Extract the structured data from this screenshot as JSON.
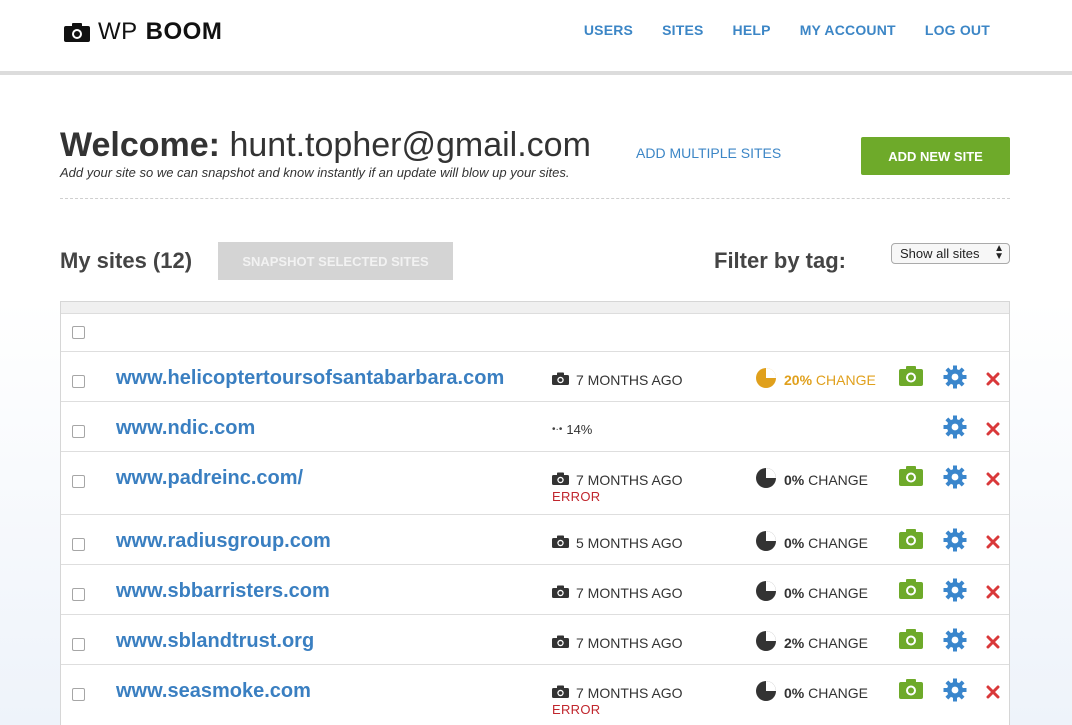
{
  "header": {
    "brand_a": "WP",
    "brand_b": "BOOM",
    "nav": [
      "USERS",
      "SITES",
      "HELP",
      "MY ACCOUNT",
      "LOG OUT"
    ]
  },
  "welcome": {
    "label": "Welcome:",
    "email": "hunt.topher@gmail.com",
    "subtitle": "Add your site so we can snapshot and know instantly if an update will blow up your sites.",
    "add_multiple": "ADD MULTIPLE SITES",
    "add_new": "ADD NEW SITE"
  },
  "toolbar": {
    "my_sites": "My sites (12)",
    "snapshot_selected": "SNAPSHOT SELECTED SITES",
    "filter_label": "Filter by tag:",
    "filter_value": "Show all sites"
  },
  "colors": {
    "link": "#3a7fc1",
    "accent_green": "#6eaa2a",
    "warn": "#e0a01c",
    "error": "#c0262d",
    "delete": "#d9383a"
  },
  "sites": [
    {
      "url": "www.helicoptertoursofsantabarbara.com",
      "when": "7 MONTHS AGO",
      "error": "",
      "pct": "20%",
      "change": "CHANGE",
      "fraction": 0.2,
      "warn": true,
      "snapshot": true
    },
    {
      "url": "www.ndic.com",
      "progress": "14%",
      "snapshot": false
    },
    {
      "url": "www.padreinc.com/",
      "when": "7 MONTHS AGO",
      "error": "ERROR",
      "pct": "0%",
      "change": "CHANGE",
      "fraction": 0.0,
      "warn": false,
      "snapshot": true
    },
    {
      "url": "www.radiusgroup.com",
      "when": "5 MONTHS AGO",
      "error": "",
      "pct": "0%",
      "change": "CHANGE",
      "fraction": 0.0,
      "warn": false,
      "snapshot": true
    },
    {
      "url": "www.sbbarristers.com",
      "when": "7 MONTHS AGO",
      "error": "",
      "pct": "0%",
      "change": "CHANGE",
      "fraction": 0.0,
      "warn": false,
      "snapshot": true
    },
    {
      "url": "www.sblandtrust.org",
      "when": "7 MONTHS AGO",
      "error": "",
      "pct": "2%",
      "change": "CHANGE",
      "fraction": 0.02,
      "warn": false,
      "snapshot": true
    },
    {
      "url": "www.seasmoke.com",
      "when": "7 MONTHS AGO",
      "error": "ERROR",
      "pct": "0%",
      "change": "CHANGE",
      "fraction": 0.0,
      "warn": false,
      "snapshot": true
    }
  ]
}
